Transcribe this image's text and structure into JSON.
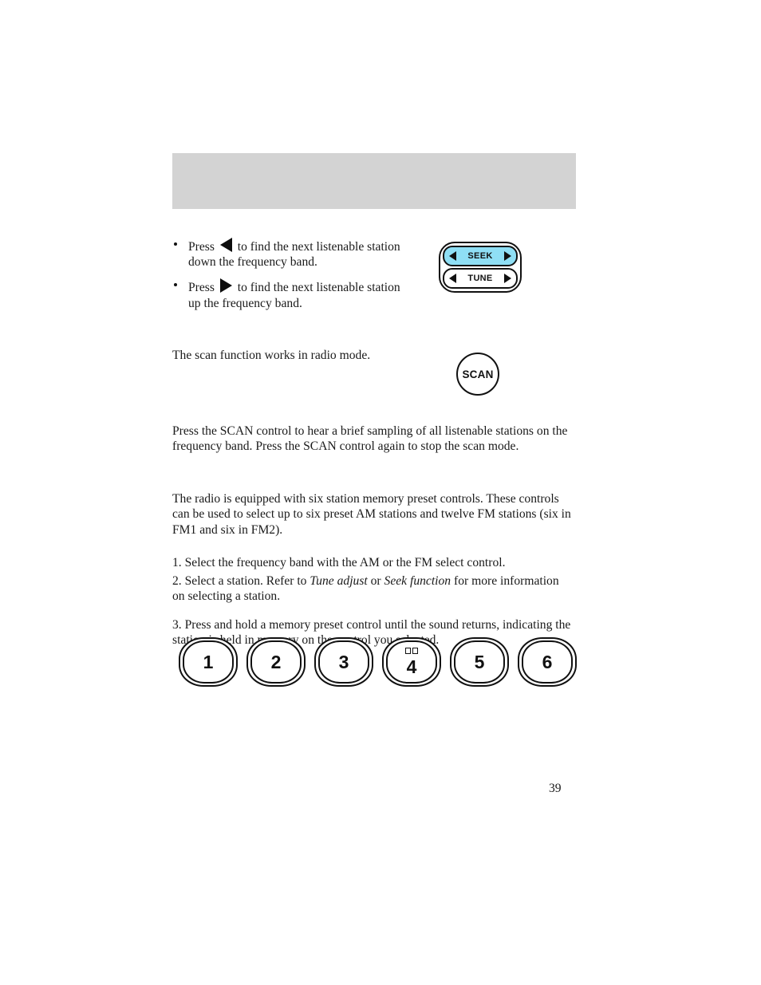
{
  "document": {
    "page_number": "39",
    "header_band_color": "#d3d3d3",
    "header_band_title": ""
  },
  "seek_section": {
    "bullets": [
      {
        "prefix": "Press",
        "arrow": "left-triangle-icon",
        "suffix": "to find the next listenable station down the frequency band."
      },
      {
        "prefix": "Press",
        "arrow": "right-triangle-icon",
        "suffix": "to find the next listenable station up the frequency band."
      }
    ],
    "control": {
      "seek_label": "SEEK",
      "tune_label": "TUNE",
      "seek_highlight_color": "#8fdff5",
      "left_arrow": "arrow-left-icon",
      "right_arrow": "arrow-right-icon"
    }
  },
  "scan_section": {
    "note": "The scan function works in radio mode.",
    "button_label": "SCAN",
    "body": "Press the SCAN control to hear a brief sampling of all listenable stations on the frequency band. Press the SCAN control again to stop the scan mode."
  },
  "preset_section": {
    "intro": "The radio is equipped with six station memory preset controls. These controls can be used to select up to six preset AM stations and twelve FM stations (six in FM1 and six in FM2).",
    "steps": [
      {
        "number": "1.",
        "text_before": "Select the frequency band with the AM or the FM select control.",
        "italic_1": "",
        "mid": "",
        "italic_2": "",
        "text_after": ""
      },
      {
        "number": "2.",
        "text_before": "Select a station. Refer to ",
        "italic_1": "Tune adjust",
        "mid": " or ",
        "italic_2": "Seek function",
        "text_after": " for more information on selecting a station."
      },
      {
        "number": "3.",
        "text_before": "Press and hold a memory preset control until the sound returns, indicating the station is held in memory on the control you selected.",
        "italic_1": "",
        "mid": "",
        "italic_2": "",
        "text_after": ""
      }
    ],
    "buttons": [
      {
        "label": "1",
        "symbol": false
      },
      {
        "label": "2",
        "symbol": false
      },
      {
        "label": "3",
        "symbol": false
      },
      {
        "label": "4",
        "symbol": true
      },
      {
        "label": "5",
        "symbol": false
      },
      {
        "label": "6",
        "symbol": false
      }
    ]
  }
}
